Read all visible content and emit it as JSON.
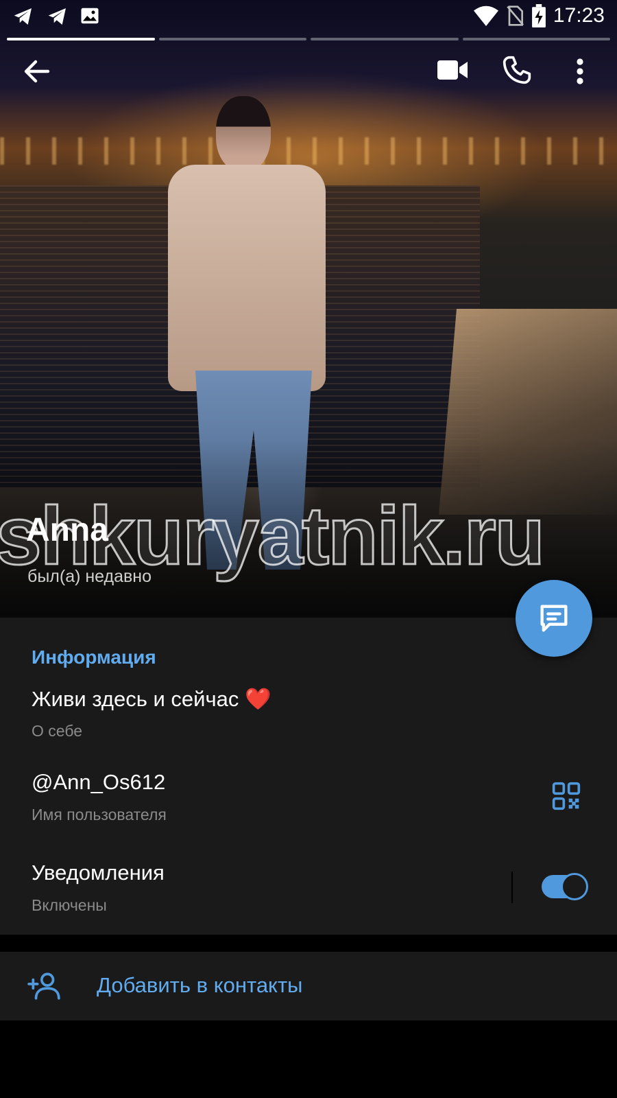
{
  "status_bar": {
    "time": "17:23",
    "left_icons": [
      "telegram-icon",
      "telegram-icon",
      "image-icon"
    ],
    "right_icons": [
      "wifi-icon",
      "no-sim-icon",
      "battery-charging-icon"
    ]
  },
  "stories": {
    "count": 4,
    "active_index": 0
  },
  "header": {
    "back_icon": "arrow-left-icon",
    "video_icon": "video-camera-icon",
    "call_icon": "phone-icon",
    "more_icon": "more-vertical-icon"
  },
  "profile": {
    "name": "Anna",
    "status": "был(а) недавно",
    "watermark": "shkuryatnik.ru"
  },
  "fab": {
    "icon": "message-icon"
  },
  "info": {
    "title": "Информация",
    "bio": "Живи здесь и сейчас ❤️",
    "bio_label": "О себе",
    "username": "@Ann_Os612",
    "username_label": "Имя пользователя",
    "qr_icon": "qr-code-icon",
    "notifications": "Уведомления",
    "notifications_status": "Включены",
    "notifications_enabled": true
  },
  "add_contact": {
    "label": "Добавить в контакты",
    "icon": "add-user-icon"
  },
  "colors": {
    "accent": "#4f99dc",
    "accent_text": "#60acef",
    "panel": "#1a1a1b",
    "background": "#000000"
  }
}
